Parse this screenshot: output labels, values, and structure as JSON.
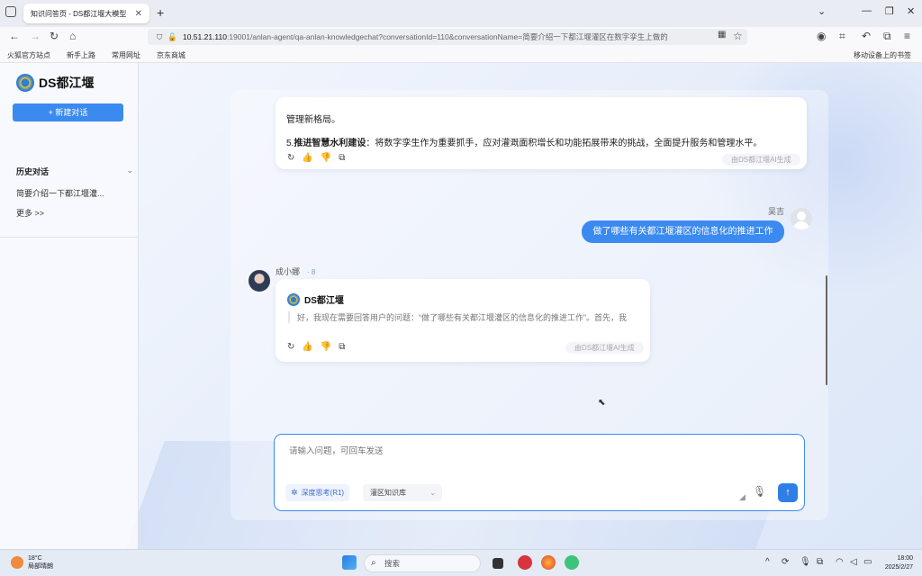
{
  "browser": {
    "tab_title": "知识问答页 - DS都江堰大模型",
    "url_host": "10.51.21.110",
    "url_rest": ":19001/anlan-agent/qa-anlan-knowledgechat?conversationId=110&conversationName=简要介绍一下都江堰灌区在数字孪生上做的",
    "bookmarks": [
      "火狐官方站点",
      "新手上路",
      "常用网址",
      "京东商城"
    ],
    "bookmarks_right": "移动设备上的书签"
  },
  "sidebar": {
    "brand": "DS都江堰",
    "new_chat": "+ 新建对话",
    "history_title": "历史对话",
    "history_items": [
      "简要介绍一下都江堰灌..."
    ],
    "more": "更多 >>"
  },
  "chat": {
    "prev_answer_line1": "管理新格局。",
    "prev_answer_point_num": "5.",
    "prev_answer_point_bold": "推进智慧水利建设",
    "prev_answer_point_text": "：将数字孪生作为重要抓手，应对灌溉面积增长和功能拓展带来的挑战，全面提升服务和管理水平。",
    "ai_badge": "由DS都江堰AI生成",
    "user_name": "吴吉",
    "user_message": "做了哪些有关都江堰灌区的信息化的推进工作",
    "bot_name": "成小娜",
    "bot_status": "· 8",
    "bot_brand": "DS都江堰",
    "bot_thinking": "好，我现在需要回答用户的问题：“做了哪些有关都江堰灌区的信息化的推进工作”。首先，我",
    "ai_badge2": "由DS都江堰AI生成"
  },
  "input": {
    "placeholder": "请输入问题，可回车发送",
    "deep_think": "深度思考(R1)",
    "kb_select": "灌区知识库"
  },
  "taskbar": {
    "weather_temp": "18°C",
    "weather_desc": "局部晴朗",
    "search": "搜索",
    "time": "18:00",
    "date": "2025/2/27"
  }
}
